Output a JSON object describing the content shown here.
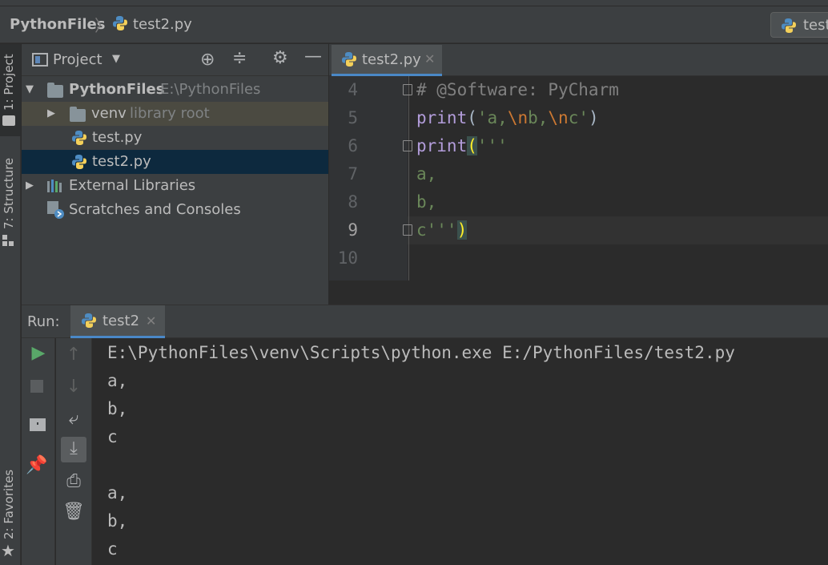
{
  "breadcrumb": {
    "root": "PythonFiles",
    "separator": "〉",
    "file": "test2.py"
  },
  "run_config": {
    "label": "test"
  },
  "left_strip": {
    "project": "1: Project",
    "structure": "7: Structure",
    "favorites": "2: Favorites"
  },
  "project_panel": {
    "view_label": "Project",
    "tree": [
      {
        "name": "PythonFiles",
        "path": "E:\\PythonFiles"
      },
      {
        "name": "venv",
        "hint": "library root"
      },
      {
        "name": "test.py"
      },
      {
        "name": "test2.py"
      },
      {
        "name": "External Libraries"
      },
      {
        "name": "Scratches and Consoles"
      }
    ]
  },
  "editor": {
    "tab_label": "test2.py",
    "line_numbers": [
      "4",
      "5",
      "6",
      "7",
      "8",
      "9",
      "10"
    ],
    "lines": {
      "l4": "# @Software: PyCharm",
      "l5_kw": "print",
      "l5_open": "(",
      "l5_s1": "'a,",
      "l5_e1": "\\n",
      "l5_s2": "b,",
      "l5_e2": "\\n",
      "l5_s3": "c'",
      "l5_close": ")",
      "l6_kw": "print",
      "l6_open": "(",
      "l6_str": "'''",
      "l7": "a,",
      "l8": "b,",
      "l9_str": "c'''",
      "l9_close": ")"
    }
  },
  "run": {
    "label": "Run:",
    "tab_label": "test2",
    "console": [
      "E:\\PythonFiles\\venv\\Scripts\\python.exe E:/PythonFiles/test2.py",
      "a,",
      "b,",
      "c",
      "",
      "a,",
      "b,",
      "c"
    ]
  }
}
